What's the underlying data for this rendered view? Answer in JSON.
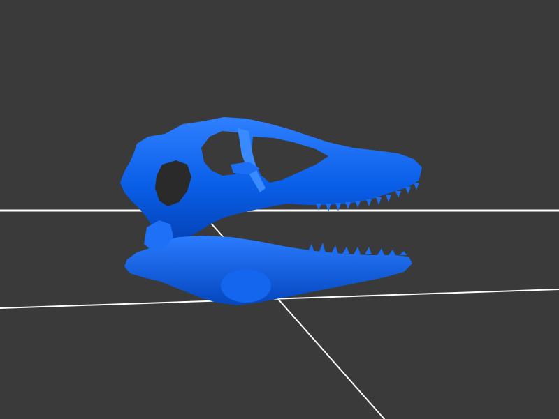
{
  "scene": {
    "background_color": "#3a3a3a",
    "model_color": "#0a5fe8",
    "model_shadow": "#0443b8",
    "model_highlight": "#2f80ff",
    "grid_line_color": "#ffffff",
    "model": "skull-mesh"
  }
}
